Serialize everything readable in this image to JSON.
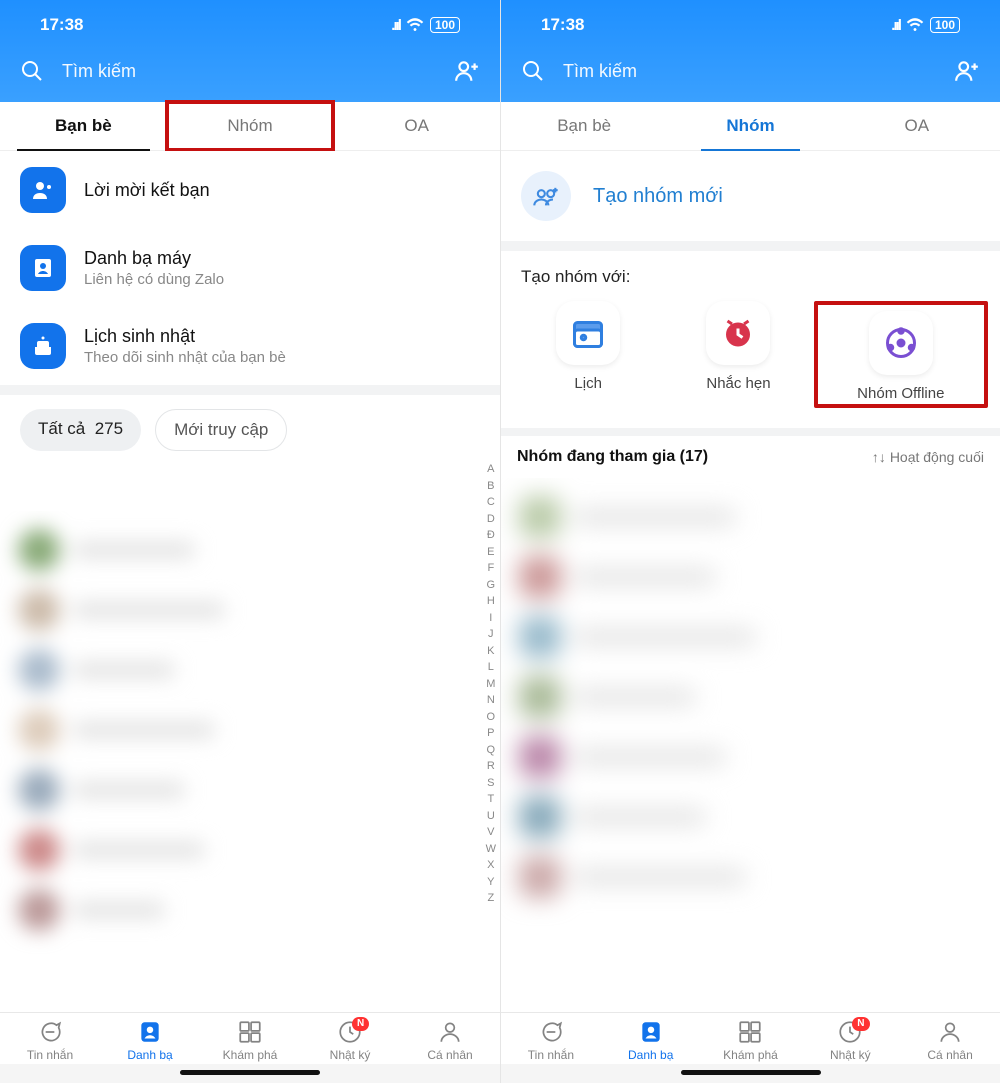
{
  "status": {
    "time": "17:38",
    "battery": "100"
  },
  "search": {
    "placeholder": "Tìm kiếm"
  },
  "tabs": {
    "friends": "Bạn bè",
    "groups": "Nhóm",
    "oa": "OA"
  },
  "left": {
    "item1": {
      "title": "Lời mời kết bạn"
    },
    "item2": {
      "title": "Danh bạ máy",
      "sub": "Liên hệ có dùng Zalo"
    },
    "item3": {
      "title": "Lịch sinh nhật",
      "sub": "Theo dõi sinh nhật của bạn bè"
    },
    "filter_all": "Tất cả",
    "filter_all_count": "275",
    "filter_recent": "Mới truy cập"
  },
  "right": {
    "create_group": "Tạo nhóm mới",
    "create_with": "Tạo nhóm với:",
    "tile1": "Lịch",
    "tile2": "Nhắc hẹn",
    "tile3": "Nhóm Offline",
    "joined_label": "Nhóm đang tham gia (17)",
    "sort_label": "Hoạt động cuối"
  },
  "alpha": [
    "A",
    "B",
    "C",
    "D",
    "Đ",
    "E",
    "F",
    "G",
    "H",
    "I",
    "J",
    "K",
    "L",
    "M",
    "N",
    "O",
    "P",
    "Q",
    "R",
    "S",
    "T",
    "U",
    "V",
    "W",
    "X",
    "Y",
    "Z"
  ],
  "nav": {
    "msg": "Tin nhắn",
    "contacts": "Danh bạ",
    "discover": "Khám phá",
    "diary": "Nhật ký",
    "me": "Cá nhân",
    "badge": "N"
  }
}
